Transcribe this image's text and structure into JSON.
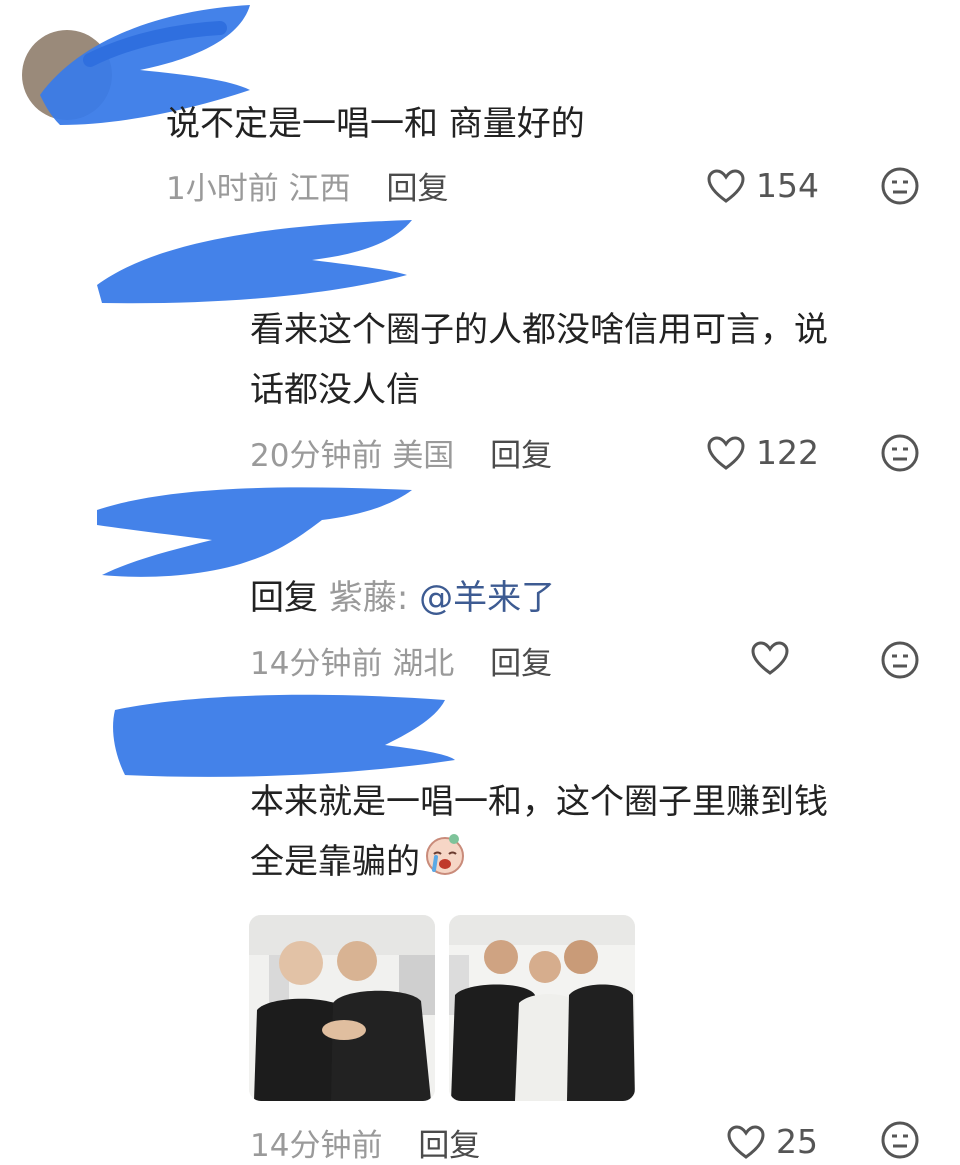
{
  "comments": [
    {
      "text": "说不定是一唱一和  商量好的",
      "time": "1小时前",
      "location": "江西",
      "reply_label": "回复",
      "likes": "154"
    },
    {
      "text_line1": "看来这个圈子的人都没啥信用可言，说",
      "text_line2": "话都没人信",
      "time": "20分钟前",
      "location": "美国",
      "reply_label": "回复",
      "likes": "122"
    },
    {
      "reply_prefix": "回复",
      "reply_to": "紫藤",
      "colon": ":",
      "mention": "@羊来了",
      "time": "14分钟前",
      "location": "湖北",
      "reply_label": "回复"
    },
    {
      "text_line1": "本来就是一唱一和，这个圈子里赚到钱",
      "text_line2": "全是靠骗的",
      "time": "14分钟前",
      "reply_label": "回复",
      "likes": "25"
    }
  ],
  "icons": {
    "like": "heart-outline-icon",
    "reaction": "neutral-face-icon",
    "emoji": "crying-face-emoji"
  },
  "colors": {
    "scribble": "#3a7be8",
    "mention": "#3d5b92",
    "meta": "#9a9a9a"
  }
}
